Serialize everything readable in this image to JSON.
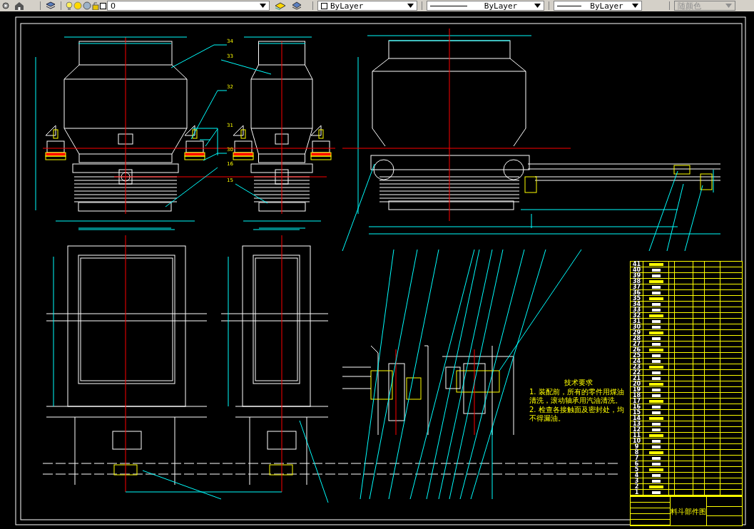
{
  "toolbar": {
    "layer": {
      "name": "0"
    },
    "color": {
      "value": "ByLayer"
    },
    "linetype": {
      "value": "ByLayer"
    },
    "lineweight": {
      "value": "ByLayer"
    },
    "plot_style": {
      "value": "随颜色",
      "disabled": true
    }
  },
  "balloons": [
    {
      "label": "34"
    },
    {
      "label": "33"
    },
    {
      "label": "32"
    },
    {
      "label": "31"
    },
    {
      "label": "30"
    },
    {
      "label": "16"
    },
    {
      "label": "15"
    }
  ],
  "tech_notes": {
    "title": "技术要求",
    "items": [
      "1. 装配前，所有的零件用煤油清洗，滚动轴承用汽油清洗。",
      "2. 检查各接触面及密封处，均不得漏油。"
    ]
  },
  "parts_list": {
    "item_numbers": [
      "41",
      "40",
      "39",
      "38",
      "37",
      "36",
      "35",
      "34",
      "33",
      "32",
      "31",
      "30",
      "29",
      "28",
      "27",
      "26",
      "25",
      "24",
      "23",
      "22",
      "21",
      "20",
      "19",
      "18",
      "17",
      "16",
      "15",
      "14",
      "13",
      "12",
      "11",
      "10",
      "9",
      "8",
      "7",
      "6",
      "5",
      "4",
      "3",
      "2",
      "1"
    ]
  },
  "title_block": {
    "drawing_title": "料斗部件图"
  }
}
